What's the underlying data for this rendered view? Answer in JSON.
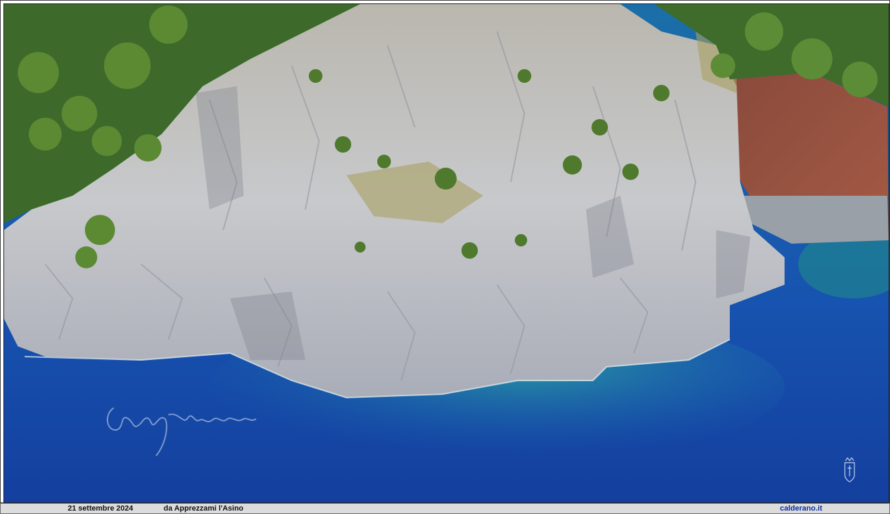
{
  "caption": {
    "date": "21 settembre 2024",
    "source": "da Apprezzami l'Asino",
    "site": "calderano.it"
  },
  "photo": {
    "subject_colors": {
      "sea_deep": "#1a4fb0",
      "sea_shallow": "#1d8a9a",
      "rock": "#c9ccd2",
      "vegetation": "#3f6b2a"
    }
  },
  "overlays": {
    "signature_icon": "handwritten-signature",
    "emblem_icon": "coat-of-arms"
  }
}
